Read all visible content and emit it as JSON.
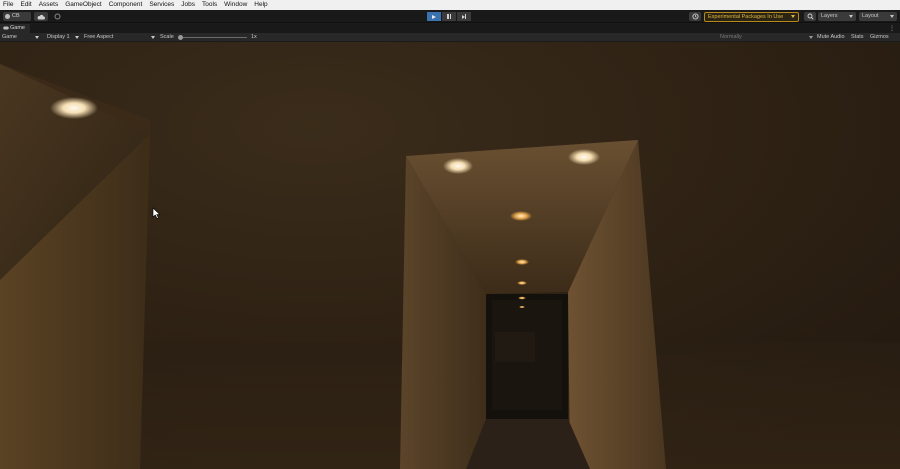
{
  "menu": [
    "File",
    "Edit",
    "Assets",
    "GameObject",
    "Component",
    "Services",
    "Jobs",
    "Tools",
    "Window",
    "Help"
  ],
  "toolbar": {
    "account_label": "CB",
    "experimental_label": "Experimental Packages In Use",
    "layers_label": "Layers",
    "layout_label": "Layout"
  },
  "tab": {
    "game_label": "Game"
  },
  "game_toolbar": {
    "view_mode": "Game",
    "display": "Display 1",
    "aspect": "Free Aspect",
    "scale_label": "Scale",
    "scale_value": "1x",
    "scale_fraction": 0.0,
    "target": "Normally",
    "mute_audio": "Mute Audio",
    "stats": "Stats",
    "gizmos": "Gizmos"
  },
  "colors": {
    "accent_play": "#3a72b0",
    "experimental_text": "#e1b43c"
  }
}
